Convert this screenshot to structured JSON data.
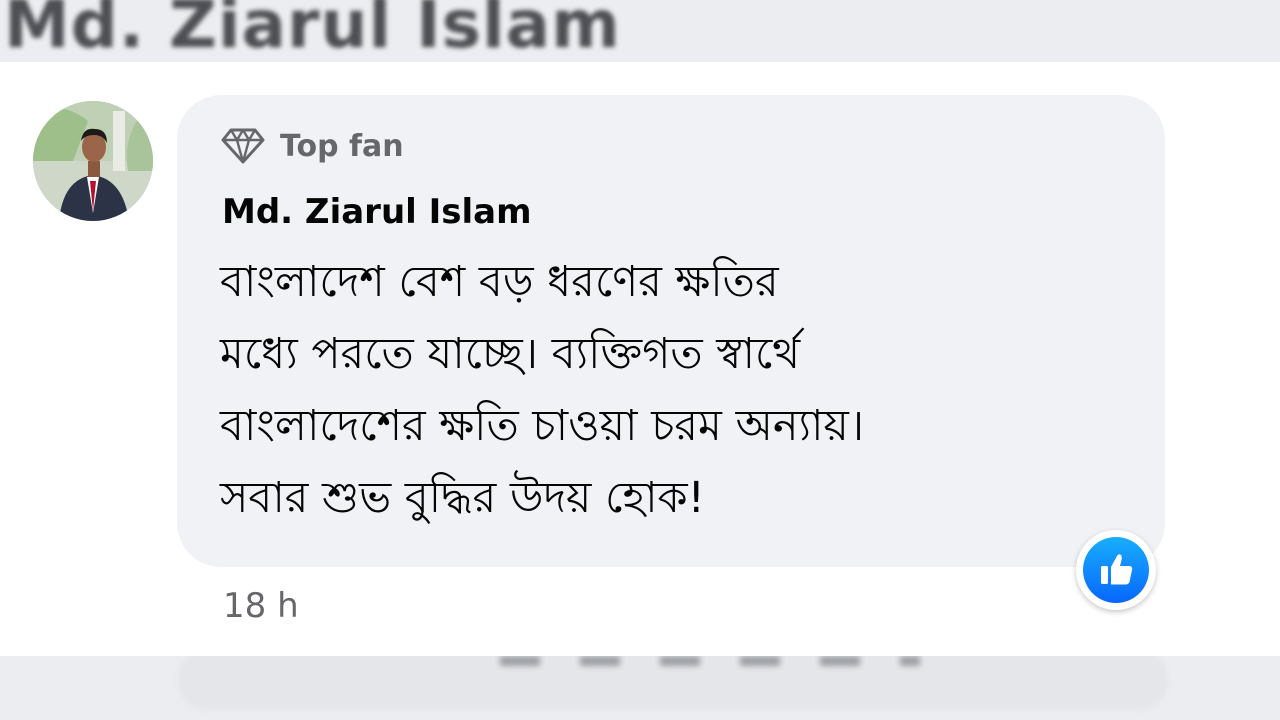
{
  "previous_comment": {
    "name_blurred": "Md. Ziarul Islam"
  },
  "comment": {
    "badge": {
      "icon": "diamond-icon",
      "label": "Top fan"
    },
    "author": "Md. Ziarul Islam",
    "text_lines": [
      "বাংলাদেশ বেশ বড় ধরণের ক্ষতির",
      "মধ্যে পরতে যাচ্ছে। ব্যক্তিগত স্বার্থে",
      "বাংলাদেশের ক্ষতি চাওয়া চরম অন্যায়।",
      "সবার শুভ বুদ্ধির উদয় হোক!"
    ],
    "reaction": {
      "icon": "thumbs-up-icon",
      "color": "#0866ff"
    },
    "timestamp": "18 h"
  },
  "colors": {
    "bubble": "#f0f2f5",
    "secondary_text": "#65676b",
    "primary_text": "#050505",
    "like_blue": "#0866ff"
  }
}
